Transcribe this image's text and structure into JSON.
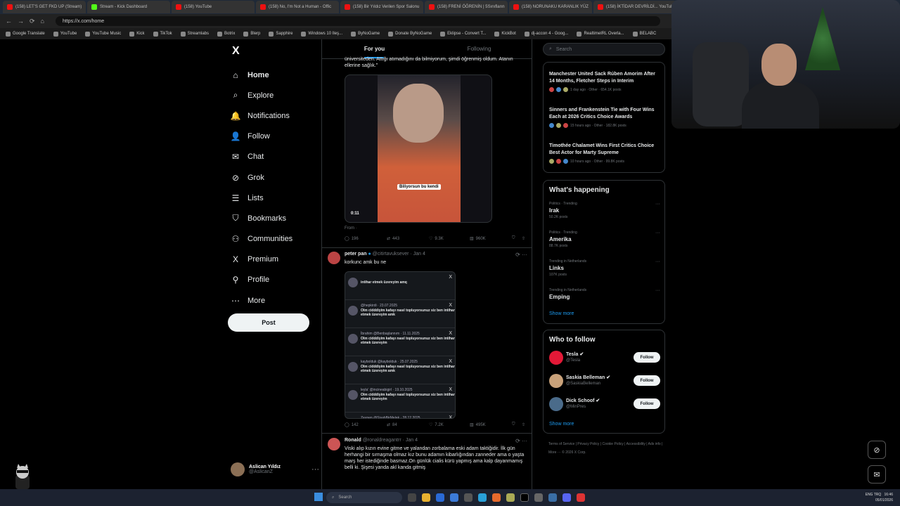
{
  "browser": {
    "tabs": [
      {
        "label": "(158) LET'S GET FKD UP (Stream)",
        "type": "yt"
      },
      {
        "label": "Stream - Kick Dashboard",
        "type": "kick"
      },
      {
        "label": "(158) YouTube",
        "type": "yt"
      },
      {
        "label": "(158) No, I'm Not a Human - Offic",
        "type": "yt"
      },
      {
        "label": "(158) Bir Yıldız Verilen Spor Salonu",
        "type": "yt"
      },
      {
        "label": "(158) FRENİ ÖĞRENİN | 5Sınıfların",
        "type": "yt"
      },
      {
        "label": "(158) NORUNAKU KARANLIK YÜZ",
        "type": "yt"
      },
      {
        "label": "(158) İKTİDAR DEVRİLDİ... YouTube",
        "type": "yt"
      }
    ],
    "url": "https://x.com/home",
    "bookmarks": [
      "Google Translate",
      "YouTube",
      "YouTube Music",
      "Kick",
      "TikTok",
      "Streamlabs",
      "Botrix",
      "Blerp",
      "Sapphire",
      "Windows 10 Ileş...",
      "ByNoGame",
      "Donate ByNoGame",
      "Eklipse - Convert T...",
      "KickBot",
      "dj-accon 4 - Goog...",
      "RealtimeIRL Overla...",
      "BELABC"
    ]
  },
  "sidebar": {
    "logo": "X",
    "items": [
      {
        "label": "Home",
        "icon": "⌂"
      },
      {
        "label": "Explore",
        "icon": "⌕"
      },
      {
        "label": "Notifications",
        "icon": "🔔"
      },
      {
        "label": "Follow",
        "icon": "👤"
      },
      {
        "label": "Chat",
        "icon": "✉"
      },
      {
        "label": "Grok",
        "icon": "⊘"
      },
      {
        "label": "Lists",
        "icon": "☰"
      },
      {
        "label": "Bookmarks",
        "icon": "⛉"
      },
      {
        "label": "Communities",
        "icon": "⚇"
      },
      {
        "label": "Premium",
        "icon": "X"
      },
      {
        "label": "Profile",
        "icon": "⚲"
      },
      {
        "label": "More",
        "icon": "⋯"
      }
    ],
    "post_label": "Post",
    "account": {
      "name": "Aslican Yıldız",
      "handle": "@AslicanZ"
    }
  },
  "feed": {
    "tabs": [
      "For you",
      "Following"
    ],
    "tweet1": {
      "text": "üniversiteden. Attığı atımadığını da bilmiyorum, şimdi öğrenmiş oldum. Atanın ellerine sağlık.\"",
      "video_caption": "Biliyorsun bu kendi",
      "video_time": "0:11",
      "from": "From ·",
      "replies": "196",
      "reposts": "443",
      "likes": "9.3K",
      "views": "960K"
    },
    "tweet2": {
      "name": "peter pan",
      "handle": "@citirtavuksever · Jan 4",
      "text": "korkunc amk bu ne",
      "shot_rows": [
        {
          "name": "",
          "text": "intihar etmek üzereyim amq"
        },
        {
          "name": "@hepkirdi · 23.07.2025",
          "text": "Olm cidddiyim kafayı nasıl topluyorsunuz siz ben intihar etmek üzereyim amk"
        },
        {
          "name": "İbrahim @Benbaşlannım · 11.11.2025",
          "text": "Olm cidddiyim kafayı nasıl topluyorsunuz siz ben intihar etmek üzereyim"
        },
        {
          "name": "kaybolduk @kaybolduk · 25.07.2025",
          "text": "Olm cidddiyim kafayı nasıl topluyorsunuz siz ben intihar etmek üzereyim amk"
        },
        {
          "name": "leyla' @incineabigirl · 19.10.2025",
          "text": "Olm cidddiyim kafayı nasıl topluyorsunuz siz ben intihar etmek üzereyim"
        },
        {
          "name": "Zeynep @SiyahBirMelek · 28.12.2025",
          "text": "Olm cidddiyim kafayı nasıl topluyorsunuz siz ben intihar etmek üzereyim amq"
        }
      ],
      "replies": "142",
      "reposts": "84",
      "likes": "7.2K",
      "views": "495K"
    },
    "tweet3": {
      "name": "Ronald",
      "handle": "@ronaldreagantrr · Jan 4",
      "text": "Viski alıp kızın evine gitme ve yalandan zorbalama eski adam taktiğidir. İlk gün herhangi bir sırnaşma olmaz kız bunu adamın kibarlığından zanneder ama o yaşta marş her istediğinde basmaz.On günlük cialis kürü yapmış ama kalp dayanmamış belli ki. Şişesi yanda akl kanda gitmiş"
    }
  },
  "right": {
    "search_placeholder": "Search",
    "trends": [
      {
        "title": "Manchester United Sack Rúben Amorim After 14 Months, Fletcher Steps in Interim",
        "meta": "1 day ago · Other · 654.1K posts"
      },
      {
        "title": "Sinners and Frankenstein Tie with Four Wins Each at 2026 Critics Choice Awards",
        "meta": "15 hours ago · Other · 182.8K posts"
      },
      {
        "title": "Timothée Chalamet Wins First Critics Choice Best Actor for Marty Supreme",
        "meta": "10 hours ago · Other · 99.8K posts"
      }
    ],
    "happening_title": "What's happening",
    "happening": [
      {
        "cat": "Politics · Trending",
        "name": "Irak",
        "posts": "50.2K posts"
      },
      {
        "cat": "Politics · Trending",
        "name": "Amerika",
        "posts": "88.7K posts"
      },
      {
        "cat": "Trending in Netherlands",
        "name": "Links",
        "posts": "107K posts"
      },
      {
        "cat": "Trending in Netherlands",
        "name": "Emping",
        "posts": ""
      }
    ],
    "show_more": "Show more",
    "wtf_title": "Who to follow",
    "follow": [
      {
        "name": "Tesla",
        "handle": "@Tesla",
        "btn": "Follow",
        "color": "#e31937"
      },
      {
        "name": "Saskia Belleman",
        "handle": "@SaskiaBelleman",
        "btn": "Follow",
        "color": "#c9a27a"
      },
      {
        "name": "Dick Schoof",
        "handle": "@MinPres",
        "btn": "Follow",
        "color": "#4a6b8a"
      }
    ],
    "footer": "Terms of Service | Privacy Policy | Cookie Policy | Accessibility | Ads info | More ··· © 2026 X Corp."
  },
  "taskbar": {
    "search": "Search",
    "lang": "ENG TRQ",
    "time": "16:46",
    "date": "05/01/2026"
  }
}
